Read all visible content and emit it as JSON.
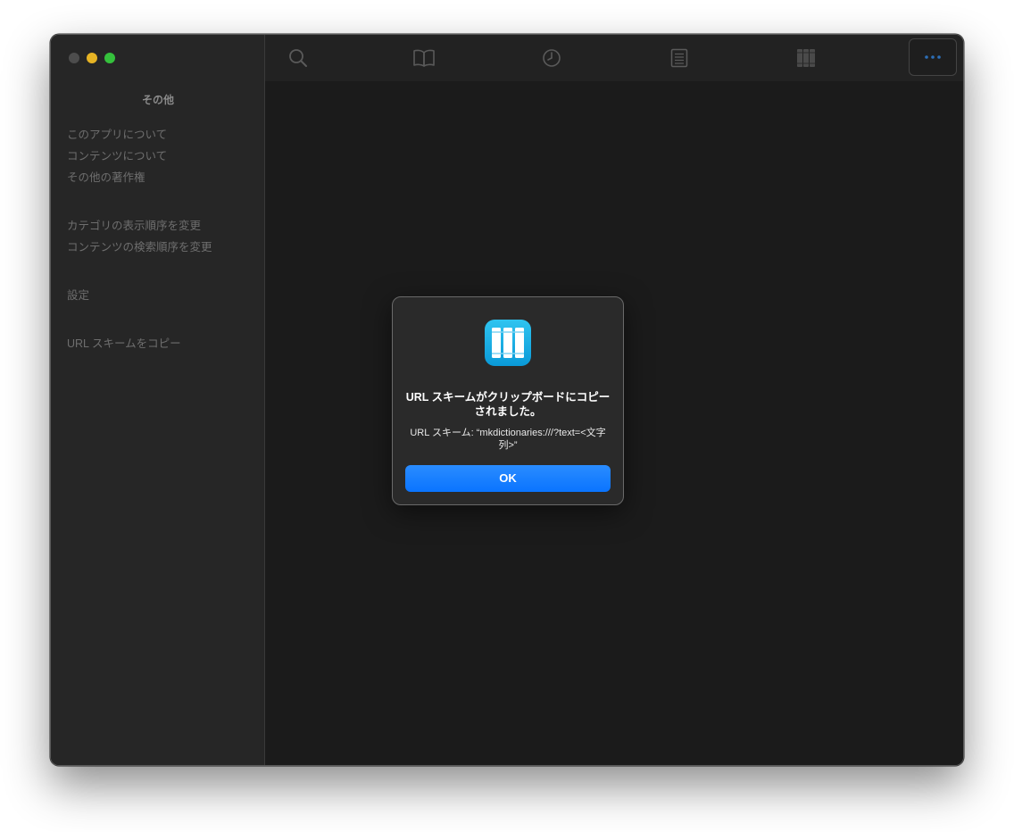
{
  "sidebar": {
    "title": "その他",
    "groups": [
      {
        "items": [
          {
            "label": "このアプリについて"
          },
          {
            "label": "コンテンツについて"
          },
          {
            "label": "その他の著作権"
          }
        ]
      },
      {
        "items": [
          {
            "label": "カテゴリの表示順序を変更"
          },
          {
            "label": "コンテンツの検索順序を変更"
          }
        ]
      },
      {
        "items": [
          {
            "label": "設定"
          }
        ]
      },
      {
        "items": [
          {
            "label": "URL スキームをコピー"
          }
        ]
      }
    ]
  },
  "toolbar": {
    "buttons": [
      {
        "icon": "search-icon"
      },
      {
        "icon": "book-icon"
      },
      {
        "icon": "clock-icon"
      },
      {
        "icon": "list-icon"
      },
      {
        "icon": "library-icon"
      },
      {
        "icon": "more-icon"
      }
    ]
  },
  "alert": {
    "title": "URL スキームがクリップボードにコピーされました。",
    "message": "URL スキーム: “mkdictionaries:///?text=<文字列>”",
    "ok_label": "OK",
    "icon": "app-library-icon"
  },
  "colors": {
    "accent": "#0a84ff",
    "window_bg": "#1b1b1b",
    "sidebar_bg": "#262626"
  }
}
